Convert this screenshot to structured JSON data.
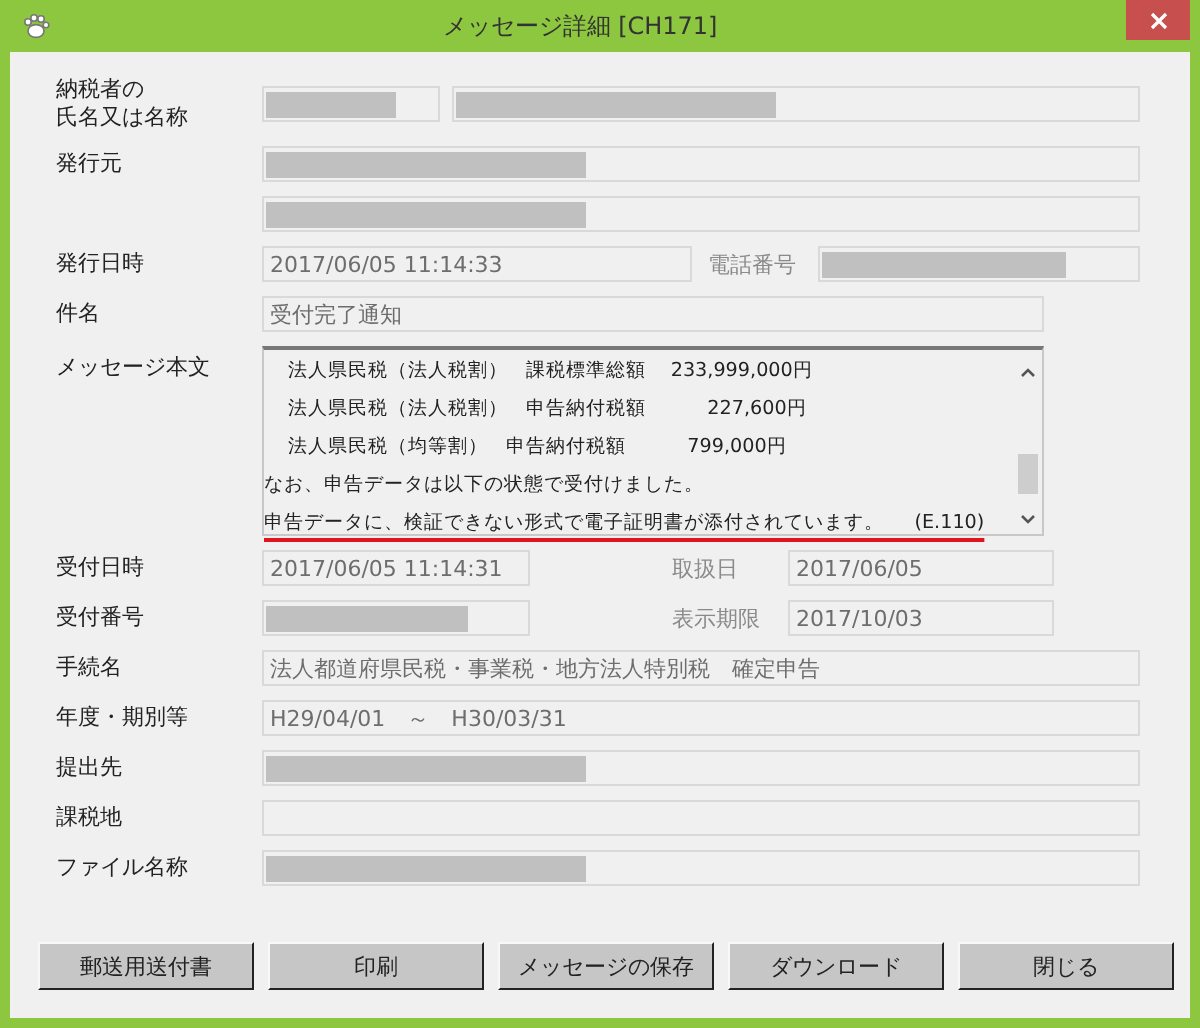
{
  "window": {
    "title": "メッセージ詳細 [CH171]"
  },
  "rows": [
    {
      "kind": "name",
      "label_lines": [
        "納税者の",
        "氏名又は名称"
      ],
      "items": [
        {
          "kind": "field",
          "redacted": true
        },
        {
          "kind": "field",
          "redacted": true
        }
      ]
    },
    {
      "kind": "full",
      "label": "発行元",
      "items": [
        {
          "kind": "field",
          "redacted": true
        }
      ]
    },
    {
      "kind": "full",
      "items": [
        {
          "kind": "field",
          "redacted": true
        }
      ]
    },
    {
      "kind": "split-long",
      "label": "発行日時",
      "items": [
        {
          "kind": "field",
          "value": "2017/06/05 11:14:33"
        },
        {
          "kind": "label",
          "value": "電話番号"
        },
        {
          "kind": "field",
          "redacted": true
        }
      ]
    },
    {
      "kind": "wide",
      "label": "件名",
      "items": [
        {
          "kind": "field",
          "value": "受付完了通知"
        }
      ]
    },
    {
      "kind": "message",
      "label": "メッセージ本文",
      "lines": [
        {
          "kind": "indented",
          "text": "法人県民税（法人税割）   課税標準総額    233,999,000円"
        },
        {
          "kind": "indented",
          "text": "法人県民税（法人税割）   申告納付税額          227,600円"
        },
        {
          "kind": "indented",
          "text": "法人県民税（均等割）   申告納付税額          799,000円"
        },
        {
          "kind": "plain",
          "text": "なお、申告データは以下の状態で受付けました。"
        },
        {
          "kind": "error",
          "text": "申告データに、検証できない形式で電子証明書が添付されています。     (E.110)"
        }
      ]
    },
    {
      "kind": "split-short",
      "label": "受付日時",
      "items": [
        {
          "kind": "field",
          "value": "2017/06/05 11:14:31"
        },
        {
          "kind": "label",
          "value": "取扱日"
        },
        {
          "kind": "field",
          "value": "2017/06/05"
        }
      ]
    },
    {
      "kind": "split-short",
      "label": "受付番号",
      "items": [
        {
          "kind": "field",
          "redacted": true
        },
        {
          "kind": "label",
          "value": "表示期限"
        },
        {
          "kind": "field",
          "value": "2017/10/03"
        }
      ]
    },
    {
      "kind": "full",
      "label": "手続名",
      "items": [
        {
          "kind": "field",
          "value": "法人都道府県民税・事業税・地方法人特別税　確定申告"
        }
      ]
    },
    {
      "kind": "full",
      "label": "年度・期別等",
      "items": [
        {
          "kind": "field",
          "value": "H29/04/01　～　H30/03/31"
        }
      ]
    },
    {
      "kind": "full",
      "label": "提出先",
      "items": [
        {
          "kind": "field",
          "redacted": true
        }
      ]
    },
    {
      "kind": "full",
      "label": "課税地",
      "items": [
        {
          "kind": "field"
        }
      ]
    },
    {
      "kind": "full",
      "label": "ファイル名称",
      "items": [
        {
          "kind": "field",
          "redacted": true
        }
      ]
    }
  ],
  "buttons": [
    "郵送用送付書",
    "印刷",
    "メッセージの保存",
    "ダウンロード",
    "閉じる"
  ]
}
